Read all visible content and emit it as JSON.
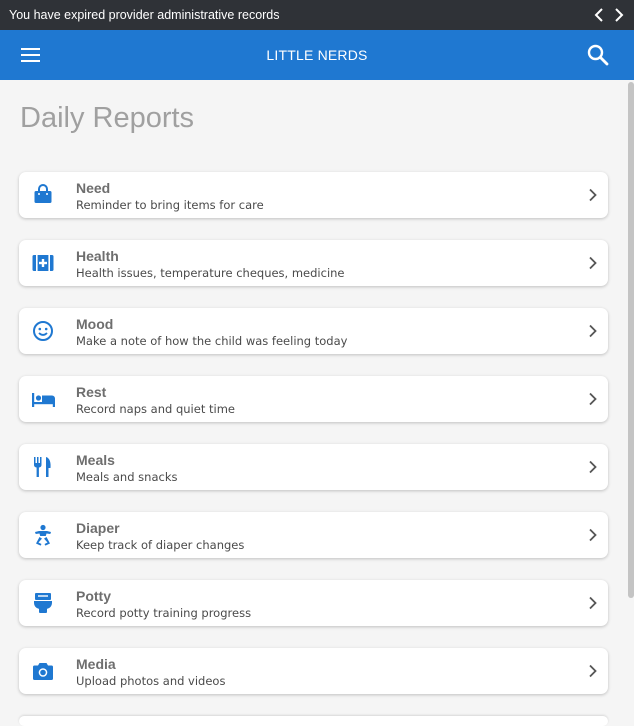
{
  "alert": {
    "message": "You have expired provider administrative records"
  },
  "app_bar": {
    "title": "LITTLE NERDS",
    "menu_icon": "hamburger-menu-icon",
    "search_icon": "search-icon"
  },
  "page": {
    "title": "Daily Reports"
  },
  "colors": {
    "accent": "#1f78d1",
    "alert_bg": "#2f3237"
  },
  "reports": [
    {
      "id": "need",
      "title": "Need",
      "subtitle": "Reminder to bring items for care",
      "icon": "shopping-bag-icon"
    },
    {
      "id": "health",
      "title": "Health",
      "subtitle": "Health issues, temperature cheques, medicine",
      "icon": "medical-kit-icon"
    },
    {
      "id": "mood",
      "title": "Mood",
      "subtitle": "Make a note of how the child was feeling today",
      "icon": "smiley-face-icon"
    },
    {
      "id": "rest",
      "title": "Rest",
      "subtitle": "Record naps and quiet time",
      "icon": "bed-icon"
    },
    {
      "id": "meals",
      "title": "Meals",
      "subtitle": "Meals and snacks",
      "icon": "fork-knife-icon"
    },
    {
      "id": "diaper",
      "title": "Diaper",
      "subtitle": "Keep track of diaper changes",
      "icon": "baby-icon"
    },
    {
      "id": "potty",
      "title": "Potty",
      "subtitle": "Record potty training progress",
      "icon": "toilet-icon"
    },
    {
      "id": "media",
      "title": "Media",
      "subtitle": "Upload photos and videos",
      "icon": "camera-icon"
    }
  ]
}
